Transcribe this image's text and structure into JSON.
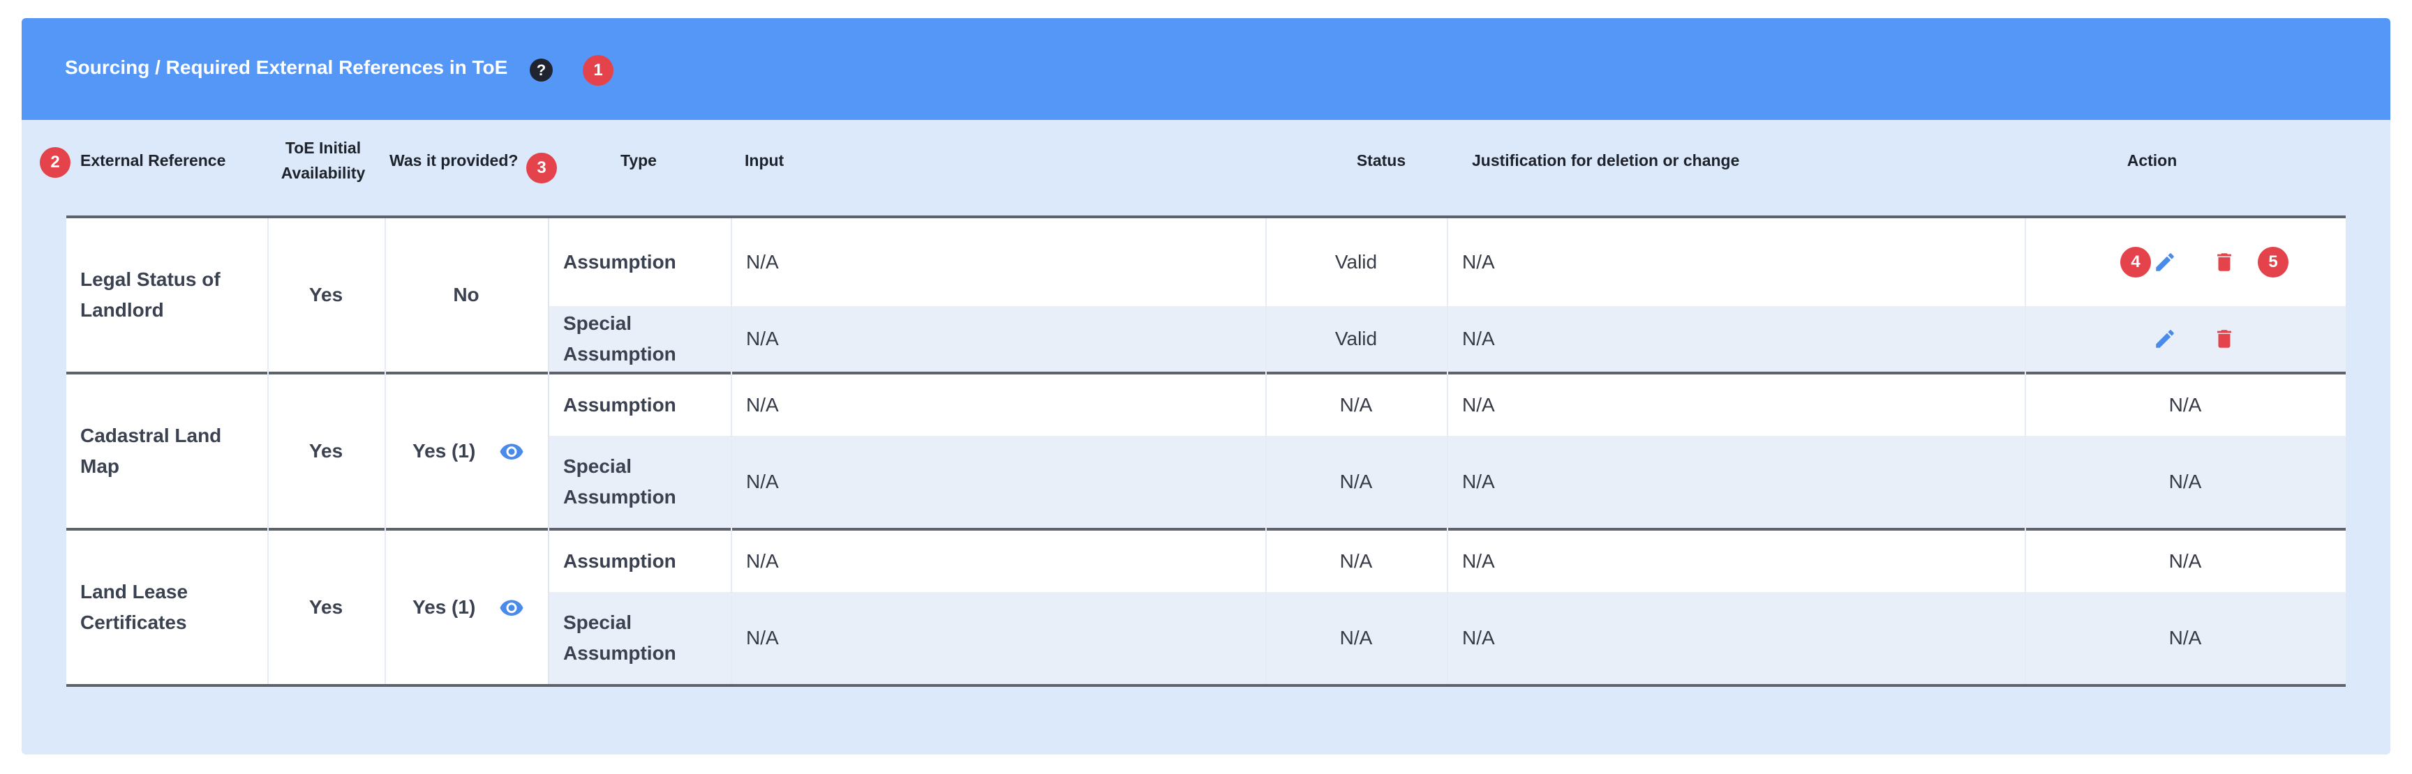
{
  "header": {
    "title": "Sourcing / Required External References in ToE",
    "help_glyph": "?",
    "badge_1": "1"
  },
  "columns": {
    "external_reference": "External Reference",
    "toe_initial_availability_line1": "ToE Initial",
    "toe_initial_availability_line2": "Availability",
    "was_it_provided": "Was it provided?",
    "type": "Type",
    "input": "Input",
    "status": "Status",
    "justification": "Justification for deletion or change",
    "action": "Action",
    "badge_2": "2",
    "badge_3": "3"
  },
  "groups": [
    {
      "reference_line1": "Legal Status of",
      "reference_line2": "Landlord",
      "availability": "Yes",
      "provided": "No",
      "rows": [
        {
          "type_line1": "Assumption",
          "type_line2": "",
          "input": "N/A",
          "status": "Valid",
          "justification": "N/A",
          "action": ""
        },
        {
          "type_line1": "Special",
          "type_line2": "Assumption",
          "input": "N/A",
          "status": "Valid",
          "justification": "N/A",
          "action": ""
        }
      ]
    },
    {
      "reference_line1": "Cadastral Land",
      "reference_line2": "Map",
      "availability": "Yes",
      "provided": "Yes (1)",
      "rows": [
        {
          "type_line1": "Assumption",
          "type_line2": "",
          "input": "N/A",
          "status": "N/A",
          "justification": "N/A",
          "action": "N/A"
        },
        {
          "type_line1": "Special",
          "type_line2": "Assumption",
          "input": "N/A",
          "status": "N/A",
          "justification": "N/A",
          "action": "N/A"
        }
      ]
    },
    {
      "reference_line1": "Land Lease",
      "reference_line2": "Certificates",
      "availability": "Yes",
      "provided": "Yes (1)",
      "rows": [
        {
          "type_line1": "Assumption",
          "type_line2": "",
          "input": "N/A",
          "status": "N/A",
          "justification": "N/A",
          "action": "N/A"
        },
        {
          "type_line1": "Special",
          "type_line2": "Assumption",
          "input": "N/A",
          "status": "N/A",
          "justification": "N/A",
          "action": "N/A"
        }
      ]
    }
  ],
  "action_badges": {
    "badge_4": "4",
    "badge_5": "5"
  },
  "icons": {
    "edit": "pencil-icon",
    "delete": "trash-icon",
    "view": "eye-icon"
  },
  "colors": {
    "header_bg": "#5597f7",
    "panel_bg": "#dce9fb",
    "badge": "#e5434b",
    "edit": "#4a8ae8",
    "delete": "#e5434b"
  }
}
